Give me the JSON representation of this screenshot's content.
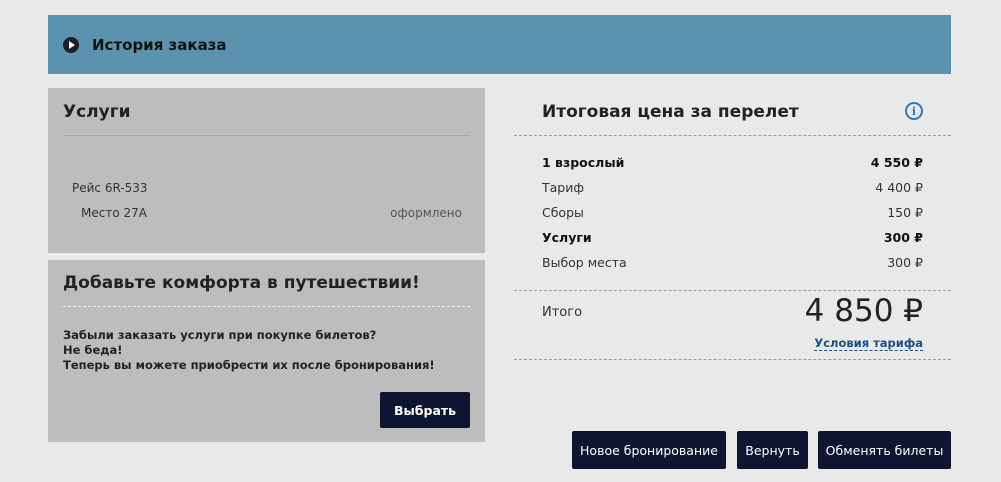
{
  "history": {
    "title": "История заказа"
  },
  "services": {
    "heading": "Услуги",
    "flight": "Рейс 6R-533",
    "seat": "Место 27А",
    "seat_status": "оформлено"
  },
  "comfort": {
    "heading": "Добавьте комфорта в путешествии!",
    "lines": [
      "Забыли заказать услуги при покупке билетов?",
      "Не беда!",
      "Теперь вы можете приобрести их после бронирования!"
    ],
    "select_label": "Выбрать"
  },
  "price": {
    "heading": "Итоговая цена за перелет",
    "info_glyph": "i",
    "rows": [
      {
        "label": "1 взрослый",
        "value": "4 550 ₽"
      },
      {
        "label": "Тариф",
        "value": "4 400 ₽"
      },
      {
        "label": "Сборы",
        "value": "150 ₽"
      },
      {
        "label": "Услуги",
        "value": "300 ₽"
      },
      {
        "label": "Выбор места",
        "value": "300 ₽"
      }
    ],
    "total_label": "Итого",
    "total_value": "4 850 ₽",
    "tariff_link": "Условия тарифа"
  },
  "actions": {
    "new_booking": "Новое бронирование",
    "return": "Вернуть",
    "exchange": "Обменять билеты"
  },
  "colors": {
    "header_bar": "#5b93ae",
    "panel": "#bdbdbd",
    "button": "#0f1530",
    "link": "#1e4f86",
    "info": "#2a7bc0"
  }
}
